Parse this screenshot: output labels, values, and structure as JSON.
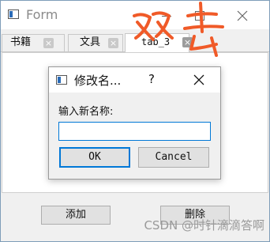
{
  "window": {
    "title": "Form"
  },
  "tabs": [
    {
      "label": "书籍"
    },
    {
      "label": "文具"
    },
    {
      "label": "tab_3"
    }
  ],
  "annotation": {
    "text": "双击",
    "color": "#f05a28"
  },
  "buttons": {
    "add": "添加",
    "delete": "删除"
  },
  "dialog": {
    "title": "修改名...",
    "help": "?",
    "prompt": "输入新名称:",
    "input_value": "",
    "ok": "OK",
    "cancel": "Cancel"
  },
  "watermark": "CSDN @时针滴滴答啊",
  "colors": {
    "accent": "#0078d7",
    "annotation": "#f05a28"
  }
}
